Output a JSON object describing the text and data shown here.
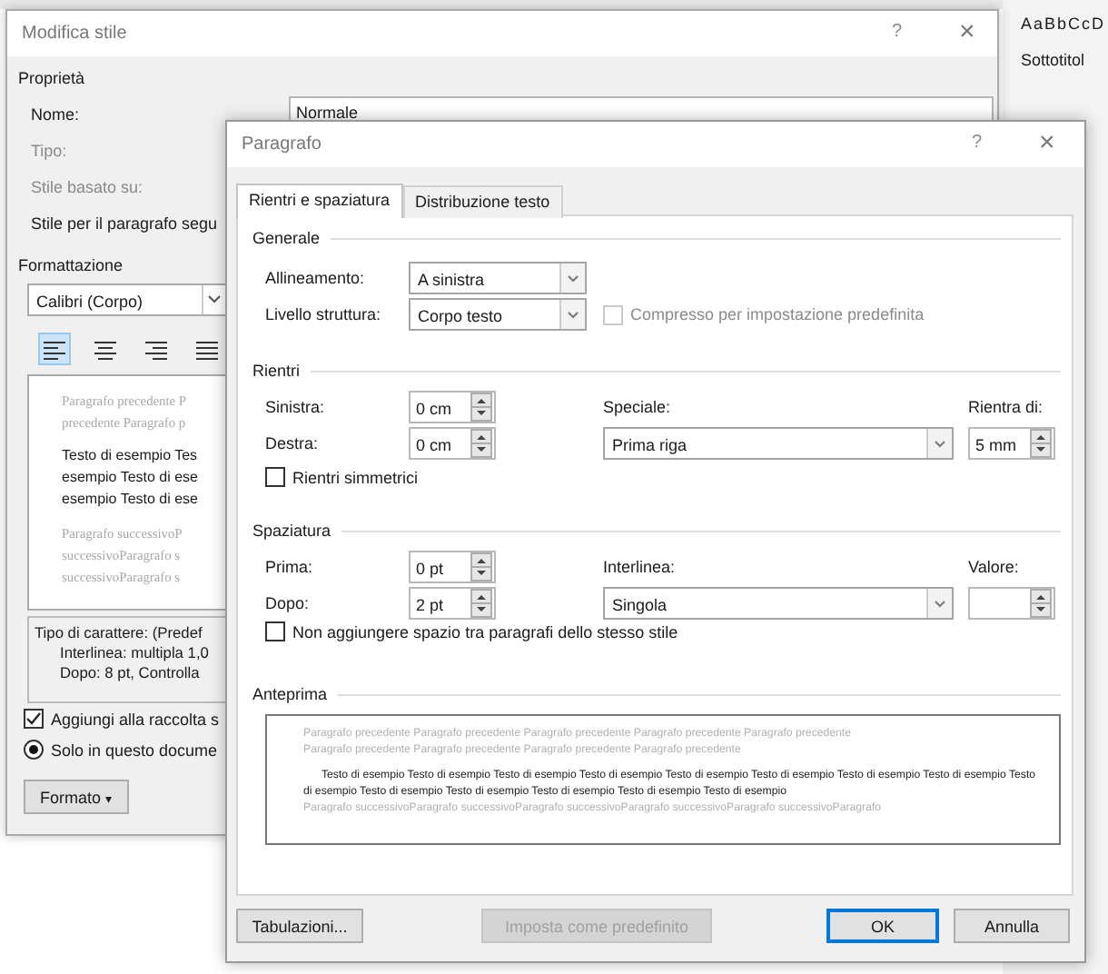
{
  "ribbon": {
    "style_preview": "AaBbCcD",
    "style_name": "Sottotitol"
  },
  "back_dialog": {
    "title": "Modifica stile",
    "help": "?",
    "close": "×",
    "properties": {
      "heading": "Proprietà",
      "fields": [
        {
          "label": "Nome:",
          "value": "Normale",
          "disabled": false
        },
        {
          "label": "Tipo:",
          "disabled": true
        },
        {
          "label": "Stile basato su:",
          "disabled": true
        },
        {
          "label": "Stile per il paragrafo segu",
          "disabled": false
        }
      ]
    },
    "formatting": {
      "heading": "Formattazione",
      "font": "Calibri (Corpo)",
      "alignments": [
        {
          "kind": "left",
          "selected": true
        },
        {
          "kind": "center",
          "selected": false
        },
        {
          "kind": "right",
          "selected": false
        },
        {
          "kind": "justify",
          "selected": false
        }
      ]
    },
    "preview": {
      "previous": [
        "Paragrafo precedente P",
        "precedente Paragrafo p"
      ],
      "sample": [
        "Testo di esempio Tes",
        "esempio Testo di ese",
        "esempio Testo di ese"
      ],
      "next": [
        "Paragrafo successivoP",
        "successivoParagrafo s",
        "successivoParagrafo s"
      ]
    },
    "description": [
      "Tipo di carattere: (Predef",
      "Interlinea: multipla 1,0",
      "Dopo:  8 pt, Controlla"
    ],
    "options": [
      {
        "kind": "checkbox",
        "label": "Aggiungi alla raccolta s",
        "checked": true
      },
      {
        "kind": "radio",
        "label": "Solo in questo docume",
        "selected": true
      }
    ],
    "format_button": "Formato",
    "format_caret": "▾"
  },
  "front_dialog": {
    "title": "Paragrafo",
    "help": "?",
    "close": "×",
    "tabs": [
      {
        "label": "Rientri e spaziatura",
        "selected": true
      },
      {
        "label": "Distribuzione testo",
        "selected": false
      }
    ],
    "general": {
      "heading": "Generale",
      "alignment": {
        "label": "Allineamento:",
        "value": "A sinistra"
      },
      "outline_level": {
        "label": "Livello struttura:",
        "value": "Corpo testo"
      },
      "collapsed": {
        "label": "Compresso per impostazione predefinita",
        "checked": false,
        "disabled": true
      }
    },
    "indents": {
      "heading": "Rientri",
      "left": {
        "label": "Sinistra:",
        "value": "0 cm"
      },
      "right": {
        "label": "Destra:",
        "value": "0 cm"
      },
      "special": {
        "label": "Speciale:",
        "value": "Prima riga"
      },
      "by": {
        "label": "Rientra di:",
        "value": "5 mm"
      },
      "mirror": {
        "label": "Rientri simmetrici",
        "checked": false,
        "disabled": false
      }
    },
    "spacing": {
      "heading": "Spaziatura",
      "before": {
        "label": "Prima:",
        "value": "0 pt"
      },
      "after": {
        "label": "Dopo:",
        "value": "2 pt"
      },
      "line_spacing": {
        "label": "Interlinea:",
        "value": "Singola"
      },
      "at": {
        "label": "Valore:"
      },
      "no_space": {
        "label": "Non aggiungere spazio tra paragrafi dello stesso stile",
        "checked": false,
        "disabled": false
      }
    },
    "preview": {
      "heading": "Anteprima",
      "previous": [
        "Paragrafo precedente Paragrafo precedente Paragrafo precedente Paragrafo precedente Paragrafo precedente",
        "Paragrafo precedente Paragrafo precedente Paragrafo precedente Paragrafo precedente"
      ],
      "sample": "Testo di esempio Testo di esempio Testo di esempio Testo di esempio Testo di esempio Testo di esempio Testo di esempio Testo di esempio Testo di esempio Testo di esempio Testo di esempio Testo di esempio Testo di esempio Testo di esempio",
      "next": [
        "Paragrafo successivoParagrafo successivoParagrafo successivoParagrafo successivoParagrafo successivoParagrafo"
      ]
    },
    "buttons": [
      {
        "label": "Tabulazioni...",
        "disabled": false,
        "default": false
      },
      {
        "label": "Imposta come predefinito",
        "disabled": true,
        "default": false
      },
      {
        "label": "OK",
        "disabled": false,
        "default": true
      },
      {
        "label": "Annulla",
        "disabled": false,
        "default": false
      }
    ]
  }
}
